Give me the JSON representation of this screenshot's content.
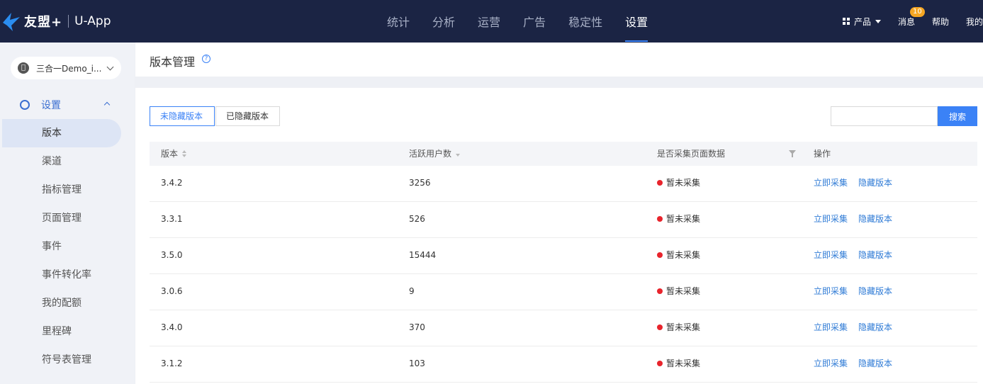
{
  "brand": {
    "name": "友盟+",
    "app": "U-App"
  },
  "nav": {
    "items": [
      {
        "label": "统计"
      },
      {
        "label": "分析"
      },
      {
        "label": "运营"
      },
      {
        "label": "广告"
      },
      {
        "label": "稳定性"
      },
      {
        "label": "设置",
        "active": true
      }
    ]
  },
  "toolbar": {
    "product_label": "产品",
    "messages_label": "消息",
    "messages_count": "10",
    "help_label": "帮助",
    "mine_label": "我的"
  },
  "sidebar": {
    "app_name": "三合一Demo_i...",
    "group_label": "设置",
    "items": [
      {
        "label": "版本",
        "active": true
      },
      {
        "label": "渠道"
      },
      {
        "label": "指标管理"
      },
      {
        "label": "页面管理"
      },
      {
        "label": "事件"
      },
      {
        "label": "事件转化率"
      },
      {
        "label": "我的配额"
      },
      {
        "label": "里程碑"
      },
      {
        "label": "符号表管理"
      }
    ]
  },
  "page": {
    "title": "版本管理"
  },
  "tabs": {
    "unhidden": "未隐藏版本",
    "hidden": "已隐藏版本"
  },
  "search": {
    "button": "搜索",
    "value": ""
  },
  "table": {
    "headers": {
      "version": "版本",
      "active_users": "活跃用户数",
      "collect": "是否采集页面数据",
      "actions": "操作"
    },
    "status_color": "#e8242c",
    "action_collect": "立即采集",
    "action_hide": "隐藏版本",
    "rows": [
      {
        "version": "3.4.2",
        "users": "3256",
        "status": "暂未采集"
      },
      {
        "version": "3.3.1",
        "users": "526",
        "status": "暂未采集"
      },
      {
        "version": "3.5.0",
        "users": "15444",
        "status": "暂未采集"
      },
      {
        "version": "3.0.6",
        "users": "9",
        "status": "暂未采集"
      },
      {
        "version": "3.4.0",
        "users": "370",
        "status": "暂未采集"
      },
      {
        "version": "3.1.2",
        "users": "103",
        "status": "暂未采集"
      }
    ]
  }
}
